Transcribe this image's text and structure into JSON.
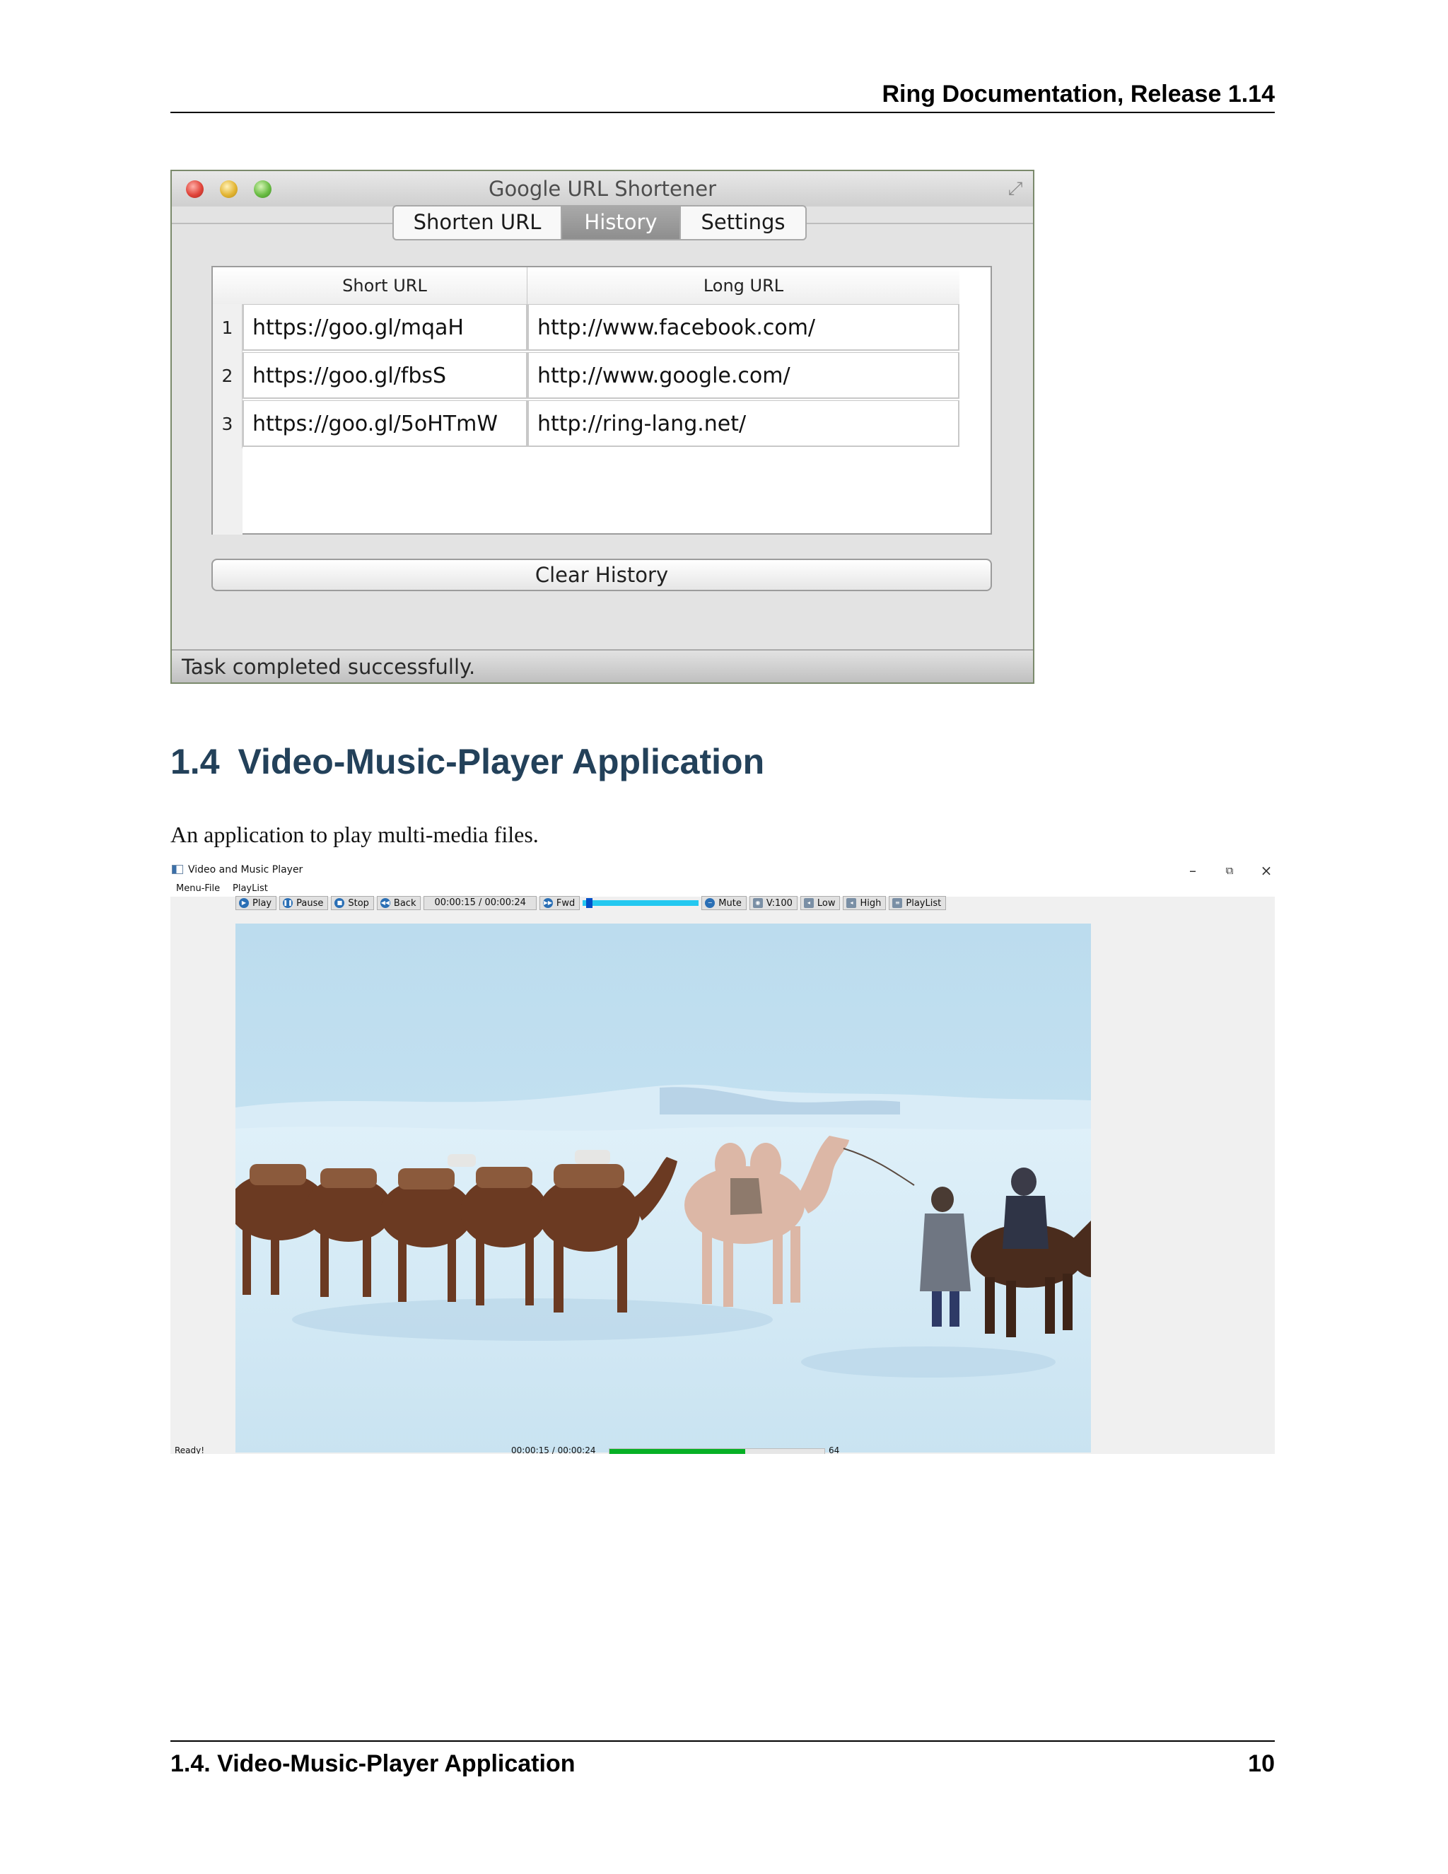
{
  "doc": {
    "header_title": "Ring Documentation, Release 1.14",
    "footer_left": "1.4.  Video-Music-Player Application",
    "footer_right": "10"
  },
  "url_app": {
    "window_title": "Google URL Shortener",
    "tabs": [
      {
        "label": "Shorten URL",
        "active": false
      },
      {
        "label": "History",
        "active": true
      },
      {
        "label": "Settings",
        "active": false
      }
    ],
    "table": {
      "columns": [
        "Short URL",
        "Long URL"
      ],
      "rows": [
        {
          "num": "1",
          "short": "https://goo.gl/mqaH",
          "long": "http://www.facebook.com/"
        },
        {
          "num": "2",
          "short": "https://goo.gl/fbsS",
          "long": "http://www.google.com/"
        },
        {
          "num": "3",
          "short": "https://goo.gl/5oHTmW",
          "long": "http://ring-lang.net/"
        }
      ]
    },
    "clear_button": "Clear History",
    "status": "Task completed successfully."
  },
  "section": {
    "number": "1.4",
    "title": "Video-Music-Player Application",
    "intro": "An application to play multi-media files."
  },
  "player": {
    "window_title": "Video and Music Player",
    "window_controls": {
      "minimize": "–",
      "maximize": "⧉",
      "close": "×"
    },
    "menu": [
      "Menu-File",
      "PlayList"
    ],
    "toolbar": {
      "play": "Play",
      "pause": "Pause",
      "stop": "Stop",
      "back": "Back",
      "time": "00:00:15 / 00:00:24",
      "fwd": "Fwd",
      "position_fraction": 0.03,
      "mute": "Mute",
      "volume": "V:100",
      "low": "Low",
      "high": "High",
      "playlist": "PlayList"
    },
    "status": "Ready!",
    "bottom_time": "00:00:15 / 00:00:24",
    "progress_fraction": 0.63,
    "bottom_extra": "64"
  },
  "colors": {
    "heading": "#23415a",
    "progress_green": "#06b025",
    "slider_cyan": "#24c8f0",
    "video_sky": "#c4e0ee"
  }
}
